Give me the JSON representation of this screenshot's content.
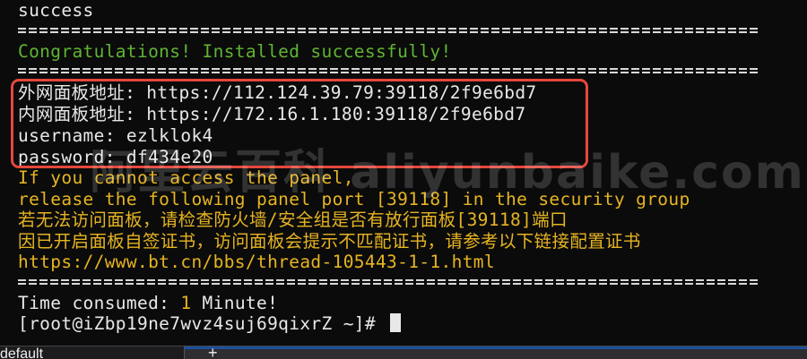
{
  "terminal": {
    "lines": {
      "status": "success",
      "congrats": "Congratulations! Installed successfully!",
      "external_url": "外网面板地址: https://112.124.39.79:39118/2f9e6bd7",
      "internal_url": "内网面板地址: https://172.16.1.180:39118/2f9e6bd7",
      "username": "username: ezlklok4",
      "password": "password: df434e20",
      "hint1": "If you cannot access the panel,",
      "hint2": "release the following panel port [39118] in the security group",
      "hint3": "若无法访问面板，请检查防火墙/安全组是否有放行面板[39118]端口",
      "hint4": "因已开启面板自签证书，访问面板会提示不匹配证书，请参考以下链接配置证书",
      "link": "https://www.bt.cn/bbs/thread-105443-1-1.html",
      "time_label": "Time consumed: ",
      "time_value": "1",
      "time_unit": " Minute!",
      "prompt": "[root@iZbp19ne7wvz4suj69qixrZ ~]# "
    }
  },
  "watermark": "阿里云百科 aliyunbaike.com",
  "tabbar": {
    "active_tab": "default",
    "new_tab_symbol": "+"
  },
  "colors": {
    "background": "#0b0b0b",
    "text": "#e8e8e8",
    "success_green": "#5fb533",
    "warning_yellow": "#e6b422",
    "highlight_red": "#e5483c"
  }
}
